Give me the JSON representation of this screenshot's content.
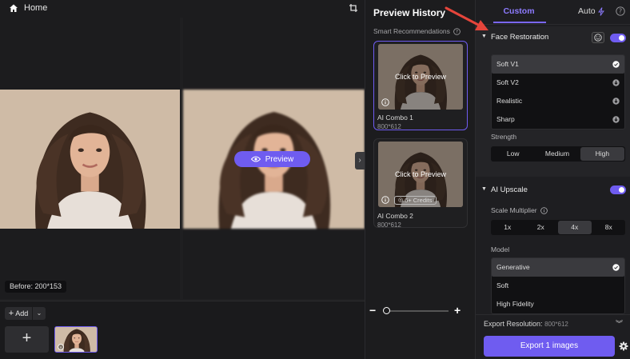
{
  "topbar": {
    "home_label": "Home"
  },
  "canvas": {
    "preview_label": "Preview",
    "before_badge": "Before: 200*153"
  },
  "bottom": {
    "add_label": "Add",
    "new_tile": "+"
  },
  "history": {
    "title": "Preview History",
    "smart_recommendations": "Smart Recommendations",
    "cards": [
      {
        "overlay": "Click to Preview",
        "name": "AI Combo 1",
        "size": "800*612",
        "credits": ""
      },
      {
        "overlay": "Click to Preview",
        "name": "AI Combo 2",
        "size": "800*612",
        "credits": "6+ Credits"
      }
    ],
    "zoom_minus": "−",
    "zoom_plus": "+",
    "zoom_level": 0
  },
  "panel": {
    "tabs": {
      "custom": "Custom",
      "auto": "Auto"
    },
    "face_restoration": {
      "title": "Face Restoration",
      "enabled": true,
      "options": [
        {
          "label": "Soft V1",
          "state": "selected"
        },
        {
          "label": "Soft V2",
          "state": "download"
        },
        {
          "label": "Realistic",
          "state": "download"
        },
        {
          "label": "Sharp",
          "state": "download"
        }
      ],
      "strength_label": "Strength",
      "strength_options": [
        "Low",
        "Medium",
        "High"
      ],
      "strength_selected": "High"
    },
    "ai_upscale": {
      "title": "AI Upscale",
      "enabled": true,
      "scale_label": "Scale Multiplier",
      "scale_options": [
        "1x",
        "2x",
        "4x",
        "8x"
      ],
      "scale_selected": "4x",
      "model_label": "Model",
      "model_options": [
        {
          "label": "Generative",
          "state": "selected"
        },
        {
          "label": "Soft",
          "state": ""
        },
        {
          "label": "High Fidelity",
          "state": ""
        }
      ]
    },
    "export": {
      "resolution_label": "Export Resolution:",
      "resolution_value": "800*612",
      "button_label": "Export 1 images"
    }
  },
  "colors": {
    "accent": "#6f5cf0",
    "annotation_arrow": "#e5453b"
  }
}
